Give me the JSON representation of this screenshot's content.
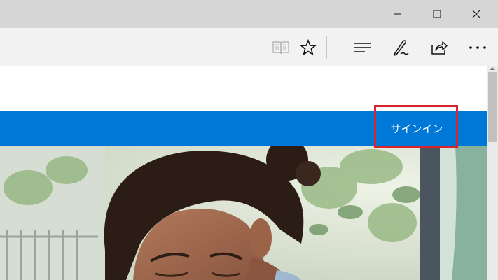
{
  "window": {
    "controls": [
      "minimize",
      "maximize",
      "close"
    ]
  },
  "toolbar": {
    "buttons": [
      {
        "name": "reading-view",
        "icon": "book-icon",
        "enabled": false
      },
      {
        "name": "favorites",
        "icon": "star-icon",
        "enabled": true
      },
      {
        "name": "hub",
        "icon": "hub-lines-icon",
        "enabled": true
      },
      {
        "name": "web-note",
        "icon": "pen-icon",
        "enabled": true
      },
      {
        "name": "share",
        "icon": "share-icon",
        "enabled": true
      },
      {
        "name": "more",
        "icon": "ellipsis-icon",
        "enabled": true
      }
    ]
  },
  "page": {
    "header_bar_color": "#0078d7",
    "signin_label": "サインイン",
    "highlight_color": "#d9232a"
  },
  "hero": {
    "image": "woman-reading-photo"
  }
}
